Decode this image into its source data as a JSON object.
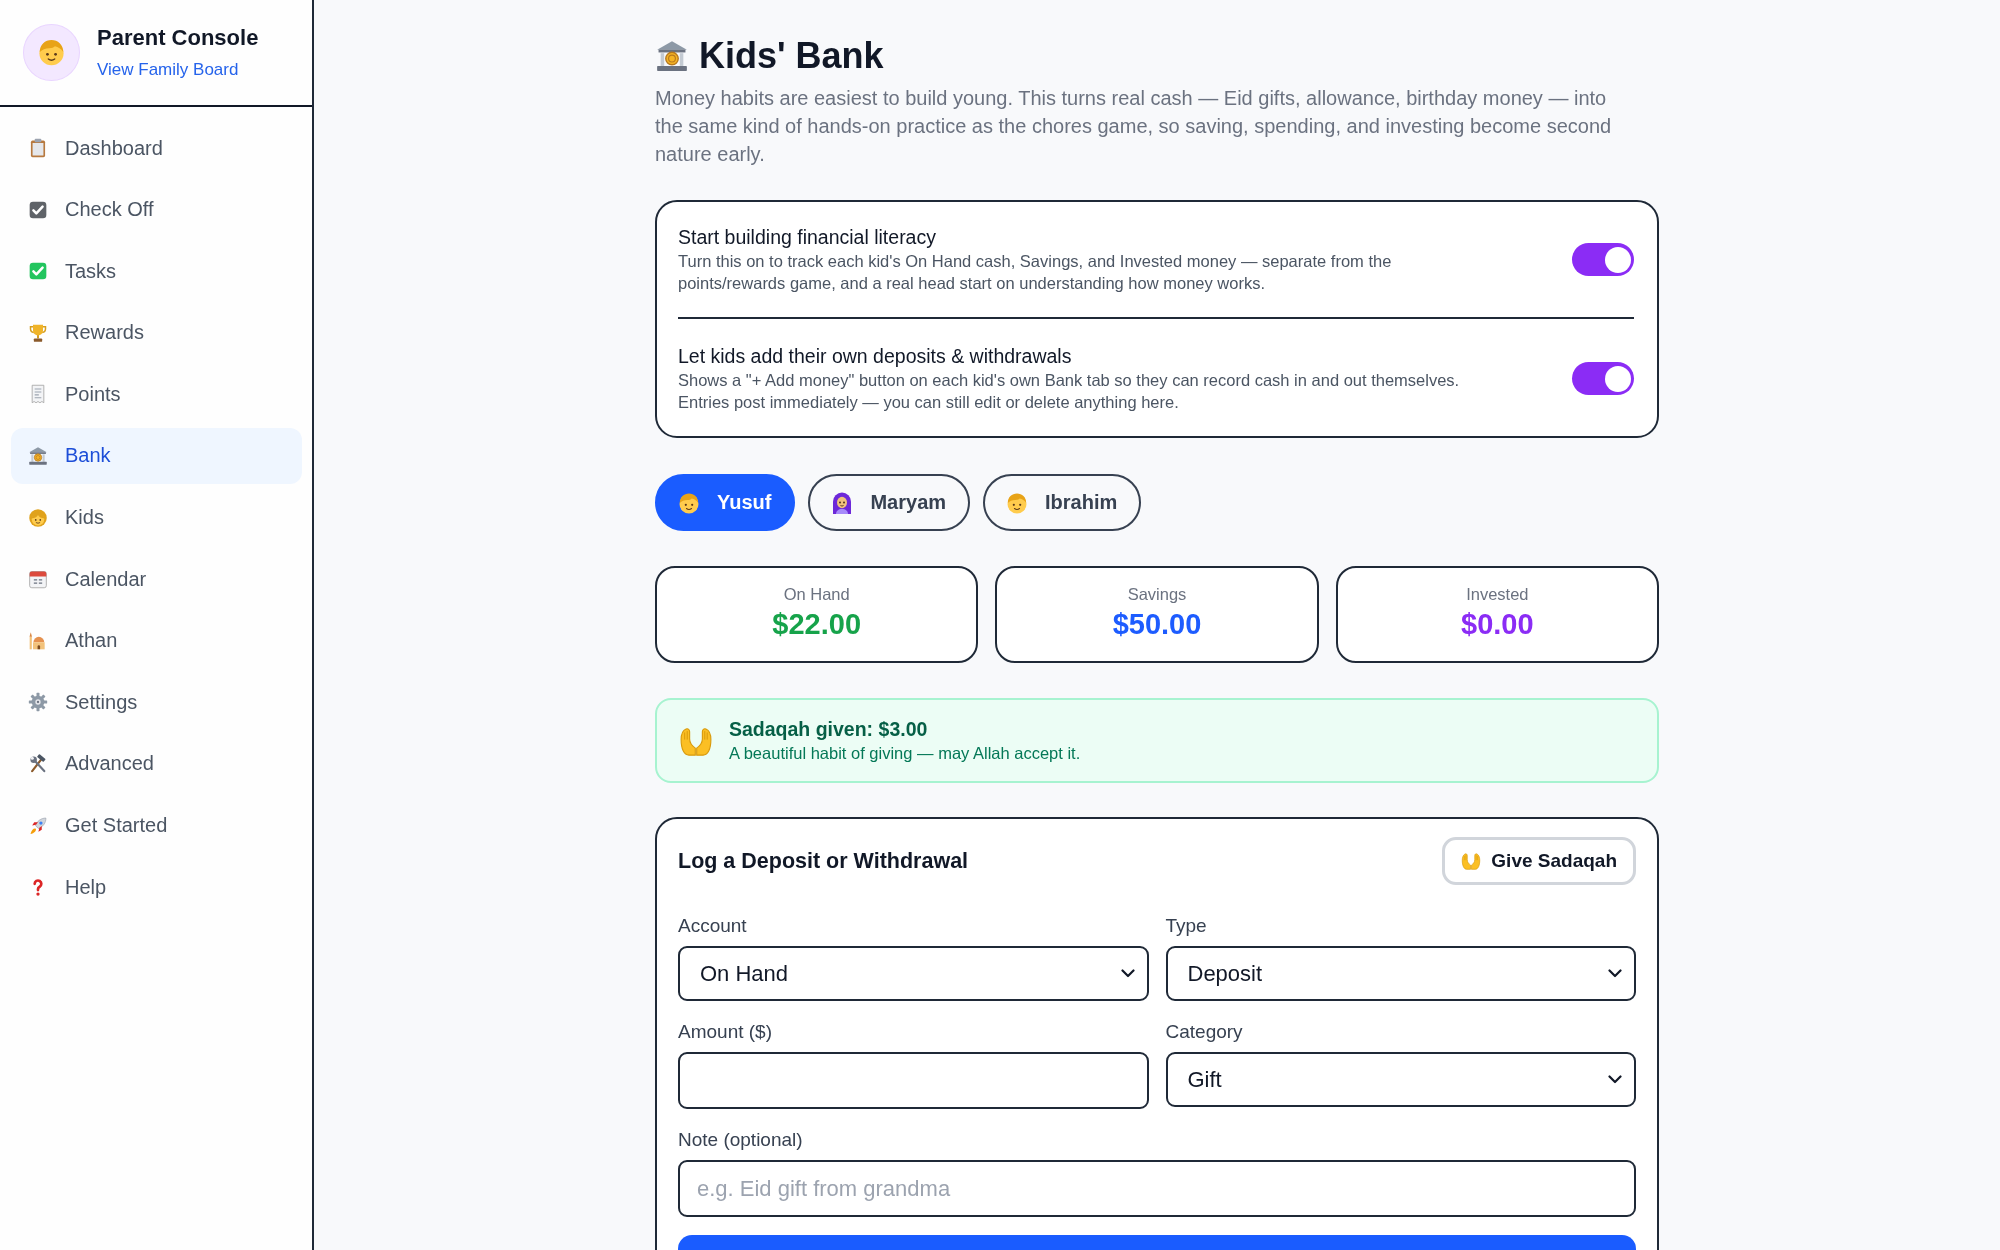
{
  "sidebar": {
    "title": "Parent Console",
    "link": "View Family Board",
    "items": [
      {
        "label": "Dashboard",
        "selected": false
      },
      {
        "label": "Check Off",
        "selected": false
      },
      {
        "label": "Tasks",
        "selected": false
      },
      {
        "label": "Rewards",
        "selected": false
      },
      {
        "label": "Points",
        "selected": false
      },
      {
        "label": "Bank",
        "selected": true
      },
      {
        "label": "Kids",
        "selected": false
      },
      {
        "label": "Calendar",
        "selected": false
      },
      {
        "label": "Athan",
        "selected": false
      },
      {
        "label": "Settings",
        "selected": false
      },
      {
        "label": "Advanced",
        "selected": false
      },
      {
        "label": "Get Started",
        "selected": false
      },
      {
        "label": "Help",
        "selected": false
      }
    ]
  },
  "header": {
    "title": "Kids' Bank",
    "description": "Money habits are easiest to build young. This turns real cash — Eid gifts, allowance, birthday money — into the same kind of hands-on practice as the chores game, so saving, spending, and investing become second nature early."
  },
  "settings": [
    {
      "title": "Start building financial literacy",
      "description": "Turn this on to track each kid's On Hand cash, Savings, and Invested money — separate from the points/rewards game, and a real head start on understanding how money works.",
      "on": true
    },
    {
      "title": "Let kids add their own deposits & withdrawals",
      "description": "Shows a \"+ Add money\" button on each kid's own Bank tab so they can record cash in and out themselves. Entries post immediately — you can still edit or delete anything here.",
      "on": true
    }
  ],
  "kids": [
    {
      "name": "Yusuf",
      "selected": true
    },
    {
      "name": "Maryam",
      "selected": false
    },
    {
      "name": "Ibrahim",
      "selected": false
    }
  ],
  "balances": [
    {
      "label": "On Hand",
      "amount": "$22.00",
      "color": "#16a34a"
    },
    {
      "label": "Savings",
      "amount": "$50.00",
      "color": "#1d5cff"
    },
    {
      "label": "Invested",
      "amount": "$0.00",
      "color": "#8b2cf5"
    }
  ],
  "sadaqah": {
    "title": "Sadaqah given: $3.00",
    "message": "A beautiful habit of giving — may Allah accept it."
  },
  "form": {
    "title": "Log a Deposit or Withdrawal",
    "button": "Give Sadaqah",
    "fields": [
      {
        "kind": "select",
        "label": "Account",
        "value": "On Hand"
      },
      {
        "kind": "select",
        "label": "Type",
        "value": "Deposit"
      },
      {
        "kind": "number",
        "label": "Amount ($)"
      },
      {
        "kind": "select",
        "label": "Category",
        "value": "Gift"
      },
      {
        "kind": "text",
        "label": "Note (optional)",
        "placeholder": "e.g. Eid gift from grandma"
      }
    ]
  }
}
